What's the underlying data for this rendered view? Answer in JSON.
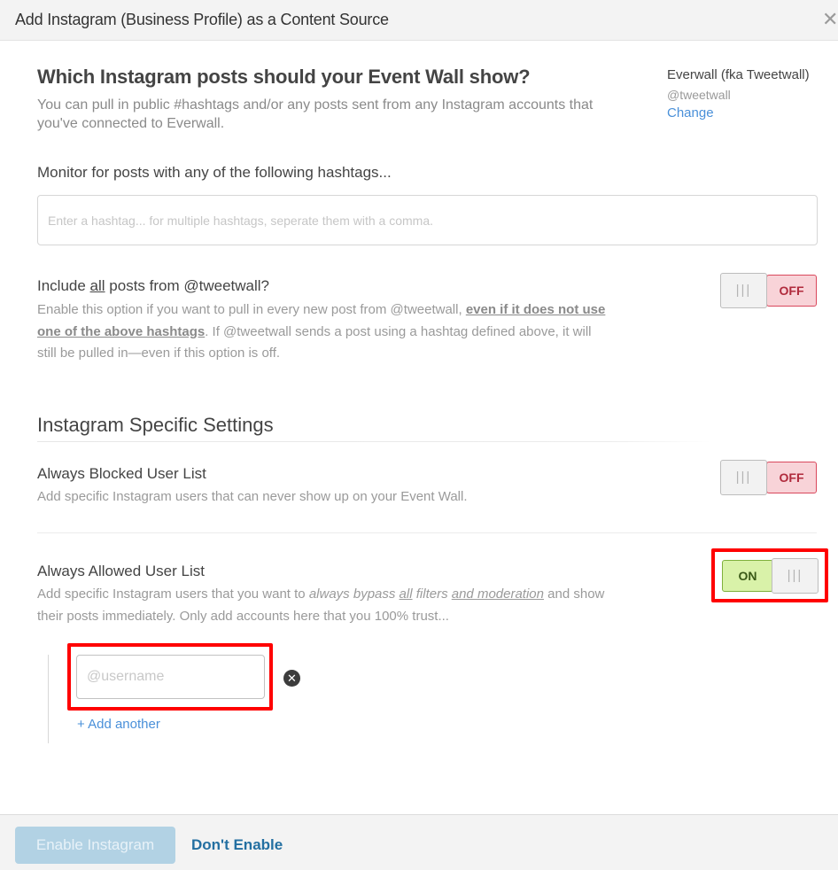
{
  "header": {
    "title": "Add Instagram (Business Profile) as a Content Source",
    "close_icon": "close-icon",
    "close_glyph": "✕"
  },
  "intro": {
    "title": "Which Instagram posts should your Event Wall show?",
    "description": "You can pull in public #hashtags and/or any posts sent from any Instagram accounts that you've connected to Everwall."
  },
  "account": {
    "name": "Everwall (fka Tweetwall)",
    "handle": "@tweetwall",
    "change_label": "Change"
  },
  "hashtags": {
    "label": "Monitor for posts with any of the following hashtags...",
    "value": "",
    "placeholder": "Enter a hashtag... for multiple hashtags, seperate them with a comma."
  },
  "include_all": {
    "title_prefix": "Include ",
    "title_emph": "all",
    "title_suffix": " posts from @tweetwall?",
    "desc_part1": "Enable this option if you want to pull in every new post from @tweetwall, ",
    "desc_emph": "even if it does not use one of the above hashtags",
    "desc_part2": ". If @tweetwall sends a post using a hashtag defined above, it will still be pulled in—even if this option is off.",
    "toggle": {
      "state": "off",
      "label": "OFF",
      "handle_glyph": "|||"
    }
  },
  "specific_settings": {
    "title": "Instagram Specific Settings",
    "blocked": {
      "title": "Always Blocked User List",
      "description": "Add specific Instagram users that can never show up on your Event Wall.",
      "toggle": {
        "state": "off",
        "label": "OFF",
        "handle_glyph": "|||"
      }
    },
    "allowed": {
      "title": "Always Allowed User List",
      "desc_part1": "Add specific Instagram users that you want to ",
      "desc_italic1": "always bypass ",
      "desc_italic_u": "all",
      "desc_italic2": " filters ",
      "desc_italic_u2": "and moderation",
      "desc_part2": " and show their posts immediately. Only add accounts here that you 100% trust...",
      "toggle": {
        "state": "on",
        "label": "ON",
        "handle_glyph": "|||"
      },
      "users": [
        {
          "value": "",
          "placeholder": "@username",
          "remove_glyph": "✕"
        }
      ],
      "add_another_label": "+ Add another"
    }
  },
  "footer": {
    "enable_label": "Enable Instagram",
    "dont_enable_label": "Don't Enable"
  },
  "colors": {
    "link": "#4a90d9",
    "off_bg": "#f8d3d8",
    "off_text": "#b02a3c",
    "on_bg": "#d9f2a9",
    "on_text": "#3a5a17",
    "highlight": "#ff0000",
    "enable_btn_bg": "#b2d2e4",
    "dont_enable": "#236fa1"
  }
}
